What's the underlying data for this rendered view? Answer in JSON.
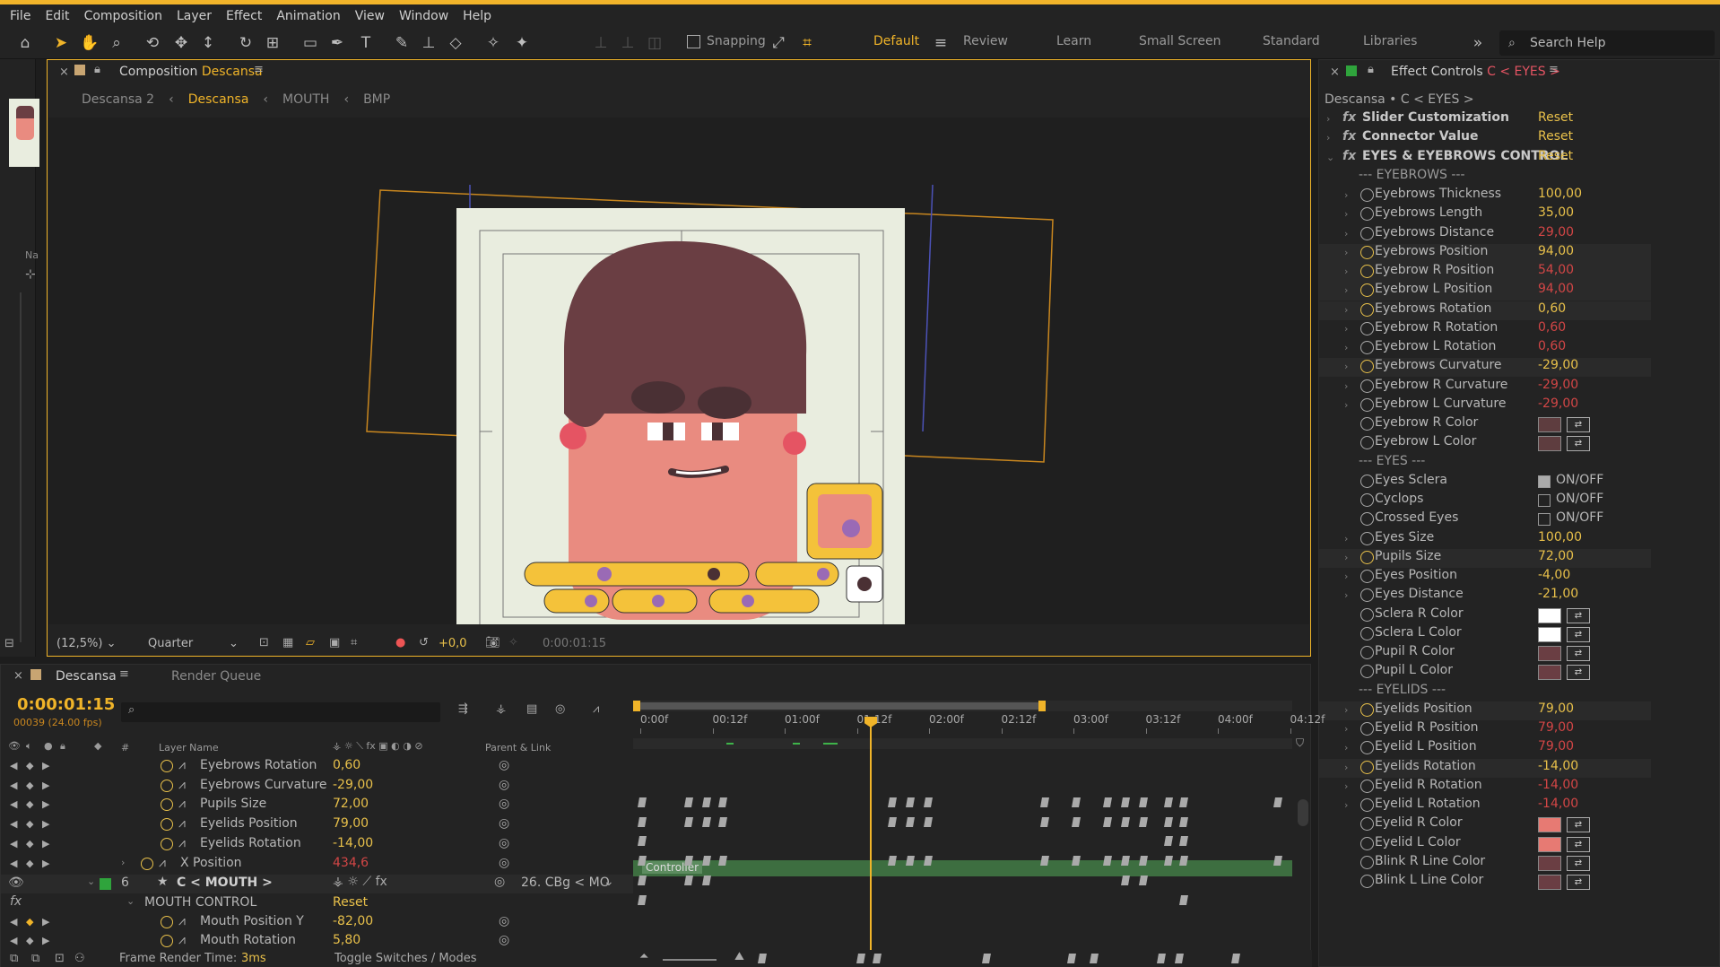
{
  "menu": [
    "File",
    "Edit",
    "Composition",
    "Layer",
    "Effect",
    "Animation",
    "View",
    "Window",
    "Help"
  ],
  "toolbar": {
    "snapping_label": "Snapping",
    "workspaces": [
      "Default",
      "Review",
      "Learn",
      "Small Screen",
      "Standard",
      "Libraries"
    ],
    "active_workspace": "Default",
    "search_placeholder": "Search Help"
  },
  "left_stub": {
    "label": "Na"
  },
  "composition_panel": {
    "title_prefix": "Composition",
    "title_name": "Descansa",
    "breadcrumbs": [
      "Descansa 2",
      "Descansa",
      "MOUTH",
      "BMP"
    ],
    "active_crumb": "Descansa",
    "zoom": "(12,5%)",
    "resolution": "Quarter",
    "exposure": "+0,0",
    "timecode": "0:00:01:15"
  },
  "effect_controls": {
    "title_prefix": "Effect Controls",
    "title_target": "C < EYES >",
    "path": "Descansa • C < EYES >",
    "rows": [
      {
        "kind": "fx",
        "label": "Slider Customization",
        "value": "Reset"
      },
      {
        "kind": "fx",
        "label": "Connector Value",
        "value": "Reset"
      },
      {
        "kind": "fx",
        "label": "EYES & EYEBROWS CONTROL",
        "value": "Reset"
      },
      {
        "kind": "sec",
        "label": "--- EYEBROWS ---"
      },
      {
        "kind": "num",
        "label": "Eyebrows Thickness",
        "value": "100,00"
      },
      {
        "kind": "num",
        "label": "Eyebrows Length",
        "value": "35,00"
      },
      {
        "kind": "num",
        "label": "Eyebrows Distance",
        "value": "29,00",
        "red": true
      },
      {
        "kind": "num",
        "label": "Eyebrows Position",
        "value": "94,00",
        "on": true
      },
      {
        "kind": "num",
        "label": "Eyebrow R Position",
        "value": "54,00",
        "red": true,
        "on": true
      },
      {
        "kind": "num",
        "label": "Eyebrow L Position",
        "value": "94,00",
        "red": true,
        "on": true
      },
      {
        "kind": "num",
        "label": "Eyebrows Rotation",
        "value": "0,60",
        "on": true
      },
      {
        "kind": "num",
        "label": "Eyebrow R Rotation",
        "value": "0,60",
        "red": true
      },
      {
        "kind": "num",
        "label": "Eyebrow L Rotation",
        "value": "0,60",
        "red": true
      },
      {
        "kind": "num",
        "label": "Eyebrows Curvature",
        "value": "-29,00",
        "on": true
      },
      {
        "kind": "num",
        "label": "Eyebrow R Curvature",
        "value": "-29,00",
        "red": true
      },
      {
        "kind": "num",
        "label": "Eyebrow L Curvature",
        "value": "-29,00",
        "red": true
      },
      {
        "kind": "color",
        "label": "Eyebrow R Color",
        "color": "#5e3d3f"
      },
      {
        "kind": "color",
        "label": "Eyebrow L Color",
        "color": "#5e3d3f"
      },
      {
        "kind": "sec",
        "label": "--- EYES ---"
      },
      {
        "kind": "check",
        "label": "Eyes Sclera",
        "value": "ON/OFF",
        "checked": true
      },
      {
        "kind": "check",
        "label": "Cyclops",
        "value": "ON/OFF",
        "checked": false
      },
      {
        "kind": "check",
        "label": "Crossed Eyes",
        "value": "ON/OFF",
        "checked": false
      },
      {
        "kind": "num",
        "label": "Eyes Size",
        "value": "100,00"
      },
      {
        "kind": "num",
        "label": "Pupils Size",
        "value": "72,00",
        "on": true
      },
      {
        "kind": "num",
        "label": "Eyes Position",
        "value": "-4,00"
      },
      {
        "kind": "num",
        "label": "Eyes Distance",
        "value": "-21,00"
      },
      {
        "kind": "color",
        "label": "Sclera R Color",
        "color": "#ffffff"
      },
      {
        "kind": "color",
        "label": "Sclera L Color",
        "color": "#ffffff"
      },
      {
        "kind": "color",
        "label": "Pupil R Color",
        "color": "#6a3e43"
      },
      {
        "kind": "color",
        "label": "Pupil L Color",
        "color": "#6a3e43"
      },
      {
        "kind": "sec",
        "label": "--- EYELIDS ---"
      },
      {
        "kind": "num",
        "label": "Eyelids Position",
        "value": "79,00",
        "on": true
      },
      {
        "kind": "num",
        "label": "Eyelid R Position",
        "value": "79,00",
        "red": true
      },
      {
        "kind": "num",
        "label": "Eyelid L Position",
        "value": "79,00",
        "red": true
      },
      {
        "kind": "num",
        "label": "Eyelids Rotation",
        "value": "-14,00",
        "on": true
      },
      {
        "kind": "num",
        "label": "Eyelid R Rotation",
        "value": "-14,00",
        "red": true
      },
      {
        "kind": "num",
        "label": "Eyelid L Rotation",
        "value": "-14,00",
        "red": true
      },
      {
        "kind": "color",
        "label": "Eyelid R Color",
        "color": "#e77a73"
      },
      {
        "kind": "color",
        "label": "Eyelid L Color",
        "color": "#e77a73"
      },
      {
        "kind": "color",
        "label": "Blink R Line Color",
        "color": "#6a3e43"
      },
      {
        "kind": "color",
        "label": "Blink L Line Color",
        "color": "#6a3e43"
      }
    ]
  },
  "timeline": {
    "tabs": [
      "Descansa",
      "Render Queue"
    ],
    "timecode": "0:00:01:15",
    "frame_info": "00039 (24.00 fps)",
    "col_layer_name": "Layer Name",
    "col_hash": "#",
    "col_parent": "Parent & Link",
    "ruler": [
      "0:00f",
      "00:12f",
      "01:00f",
      "01:12f",
      "02:00f",
      "02:12f",
      "03:00f",
      "03:12f",
      "04:00f",
      "04:12f"
    ],
    "rows": [
      {
        "name": "Eyebrows Rotation",
        "value": "0,60"
      },
      {
        "name": "Eyebrows Curvature",
        "value": "-29,00"
      },
      {
        "name": "Pupils Size",
        "value": "72,00"
      },
      {
        "name": "Eyelids Position",
        "value": "79,00"
      },
      {
        "name": "Eyelids Rotation",
        "value": "-14,00"
      },
      {
        "name": "X Position",
        "value": "434,6",
        "red": true
      }
    ],
    "layer": {
      "number": "6",
      "name": "C < MOUTH >",
      "parent": "26. CBg < MO",
      "bar_label": "Controller"
    },
    "effect_group": {
      "name": "MOUTH CONTROL",
      "value": "Reset"
    },
    "sub_rows": [
      {
        "name": "Mouth Position Y",
        "value": "-82,00"
      },
      {
        "name": "Mouth Rotation",
        "value": "5,80"
      }
    ],
    "frame_render_label": "Frame Render Time:",
    "frame_render_value": "3ms",
    "toggle_label": "Toggle Switches / Modes"
  }
}
